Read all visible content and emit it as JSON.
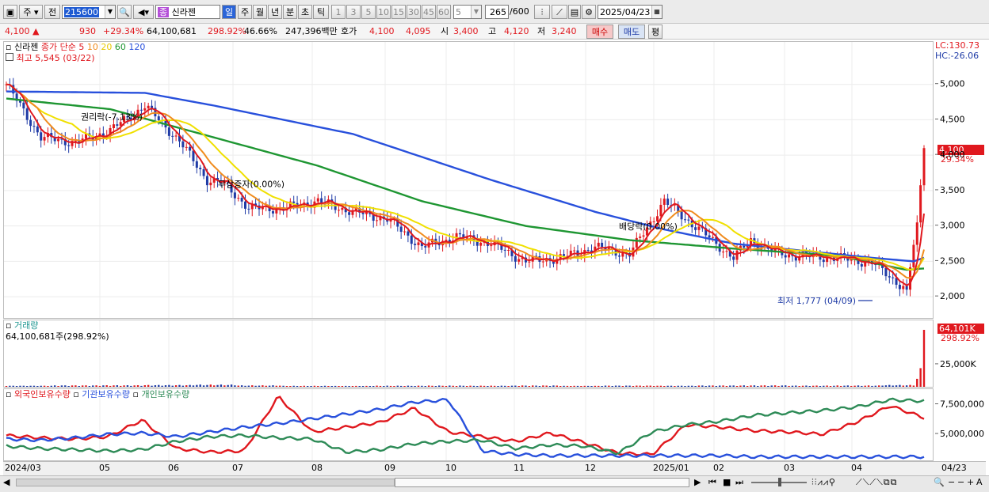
{
  "toolbar": {
    "period": "주",
    "mode": "전",
    "code": "215600",
    "name_badge": "종",
    "name": "신라젠",
    "periods": [
      "일",
      "주",
      "월",
      "년",
      "분",
      "초",
      "틱"
    ],
    "active_period": "일",
    "numbers": [
      "1",
      "3",
      "5",
      "10",
      "15",
      "30",
      "45",
      "60"
    ],
    "interval": "5",
    "count": "265",
    "count_total": "/600",
    "date": "2025/04/23"
  },
  "quote": {
    "price": "4,100",
    "arrow": "▲",
    "change": "930",
    "change_rate": "+29.34%",
    "volume": "64,100,681",
    "volume_rate": "298.92%",
    "turnover": "46.66%",
    "amount": "247,396백만",
    "bid_label": "호가",
    "bid1": "4,100",
    "bid2": "4,095",
    "open_label": "시",
    "open": "3,400",
    "high_label": "고",
    "high": "4,120",
    "low_label": "저",
    "low": "3,240",
    "buy": "매수",
    "sell": "매도",
    "eval": "평"
  },
  "legend": {
    "stock": "신라젠",
    "ma_label": "종가 단순",
    "ma_periods": [
      "5",
      "10",
      "20",
      "60",
      "120"
    ],
    "max_label": "최고 5,545 (03/22)",
    "min_label": "최저 1,777 (04/09)",
    "lc": "LC:130.73",
    "hc": "HC:-26.06",
    "price_tag": "4,100",
    "rate_tag": "29.34%",
    "volume_title": "거래량",
    "volume_label": "64,100,681주(298.92%)",
    "volume_tag": "64,101K",
    "volume_rate_tag": "298.92%",
    "holder_titles": [
      "외국인보유수량",
      "기관보유수량",
      "개인보유수량"
    ]
  },
  "colors": {
    "up": "#e0181e",
    "down": "#1f3ba6",
    "ma5": "#e0181e",
    "ma10": "#f08c1e",
    "ma20": "#f0e000",
    "ma60": "#1e9632",
    "ma120": "#2850dc",
    "foreign": "#e0181e",
    "institution": "#2850dc",
    "individual": "#2e8b57",
    "menu_up": "#e0181e",
    "menu_down": "#1f3ba6"
  },
  "x_axis_labels": [
    "2024/03",
    "05",
    "06",
    "07",
    "08",
    "09",
    "10",
    "11",
    "12",
    "2025/01",
    "02",
    "03",
    "04",
    "04/23"
  ],
  "chart_data": [
    {
      "type": "line",
      "title": "신라젠",
      "y_ticks": [
        "5,000",
        "4,500",
        "4,000",
        "3,500",
        "3,000",
        "2,500",
        "2,000"
      ],
      "ylim": [
        1700,
        5600
      ],
      "events": [
        "권리락(-7.13%)",
        "무상증자(0.00%)",
        "배당락(0.00%)"
      ],
      "series": [
        {
          "name": "종가",
          "x": [
            0,
            10,
            20,
            30,
            40,
            50,
            58,
            63,
            70,
            80,
            90,
            100,
            110,
            120,
            130,
            140,
            150,
            160,
            170,
            180,
            190,
            200,
            210,
            215,
            222,
            228,
            235,
            240,
            250,
            260,
            263,
            265
          ],
          "values": [
            5000,
            4250,
            4180,
            4350,
            4700,
            4200,
            3650,
            3600,
            3250,
            3250,
            3350,
            3200,
            3100,
            2700,
            2850,
            2750,
            2500,
            2550,
            2700,
            2600,
            3350,
            2950,
            2550,
            2800,
            2620,
            2580,
            2560,
            2550,
            2480,
            2100,
            3050,
            4100
          ]
        },
        {
          "name": "120",
          "x": [
            0,
            40,
            60,
            100,
            140,
            170,
            190,
            210,
            250,
            262,
            265
          ],
          "values": [
            4900,
            4880,
            4700,
            4300,
            3650,
            3200,
            2950,
            2750,
            2550,
            2500,
            2550
          ]
        },
        {
          "name": "60",
          "x": [
            0,
            30,
            60,
            90,
            120,
            150,
            180,
            210,
            240,
            260,
            265
          ],
          "values": [
            4800,
            4650,
            4250,
            3850,
            3350,
            3000,
            2800,
            2680,
            2580,
            2380,
            2400
          ]
        }
      ]
    },
    {
      "type": "bar",
      "title": "거래량",
      "y_ticks": [
        "25,000K"
      ],
      "values_k": [
        900,
        1200,
        1300,
        1500,
        1800,
        1200,
        800,
        700,
        900,
        1000,
        900,
        1100,
        800,
        1000,
        900,
        1100,
        1200,
        1000,
        1100,
        1500,
        9000,
        21000,
        64101
      ]
    },
    {
      "type": "line",
      "title": "보유수량",
      "y_ticks": [
        "7,500,000",
        "5,000,000"
      ],
      "series": [
        {
          "name": "외국인보유수량",
          "values": [
            4.9,
            4.7,
            4.6,
            4.8,
            6.2,
            3.8,
            3.5,
            3.6,
            8.2,
            5.2,
            5.6,
            6.0,
            7.2,
            5.2,
            4.8,
            4.4,
            5.1,
            4.3,
            3.4,
            3.3,
            5.8,
            5.6,
            5.3,
            5.2,
            5.0,
            6.0,
            7.4,
            6.4
          ]
        },
        {
          "name": "기관보유수량",
          "values": [
            4.6,
            4.5,
            4.7,
            5.0,
            5.1,
            4.8,
            5.2,
            5.6,
            5.9,
            6.3,
            6.7,
            7.1,
            7.7,
            7.9,
            3.6,
            3.3,
            3.2,
            3.2,
            3.2,
            3.2,
            3.2,
            3.2,
            3.1,
            3.1,
            3.1,
            3.1,
            3.1,
            3.1
          ]
        },
        {
          "name": "개인보유수량",
          "values": [
            4.0,
            3.8,
            3.7,
            3.6,
            3.7,
            4.4,
            4.8,
            4.9,
            4.7,
            4.6,
            3.5,
            3.7,
            4.2,
            4.4,
            4.5,
            3.8,
            4.1,
            4.0,
            3.4,
            5.2,
            5.8,
            6.1,
            6.6,
            6.8,
            7.0,
            7.3,
            7.9,
            7.8
          ]
        }
      ]
    }
  ]
}
